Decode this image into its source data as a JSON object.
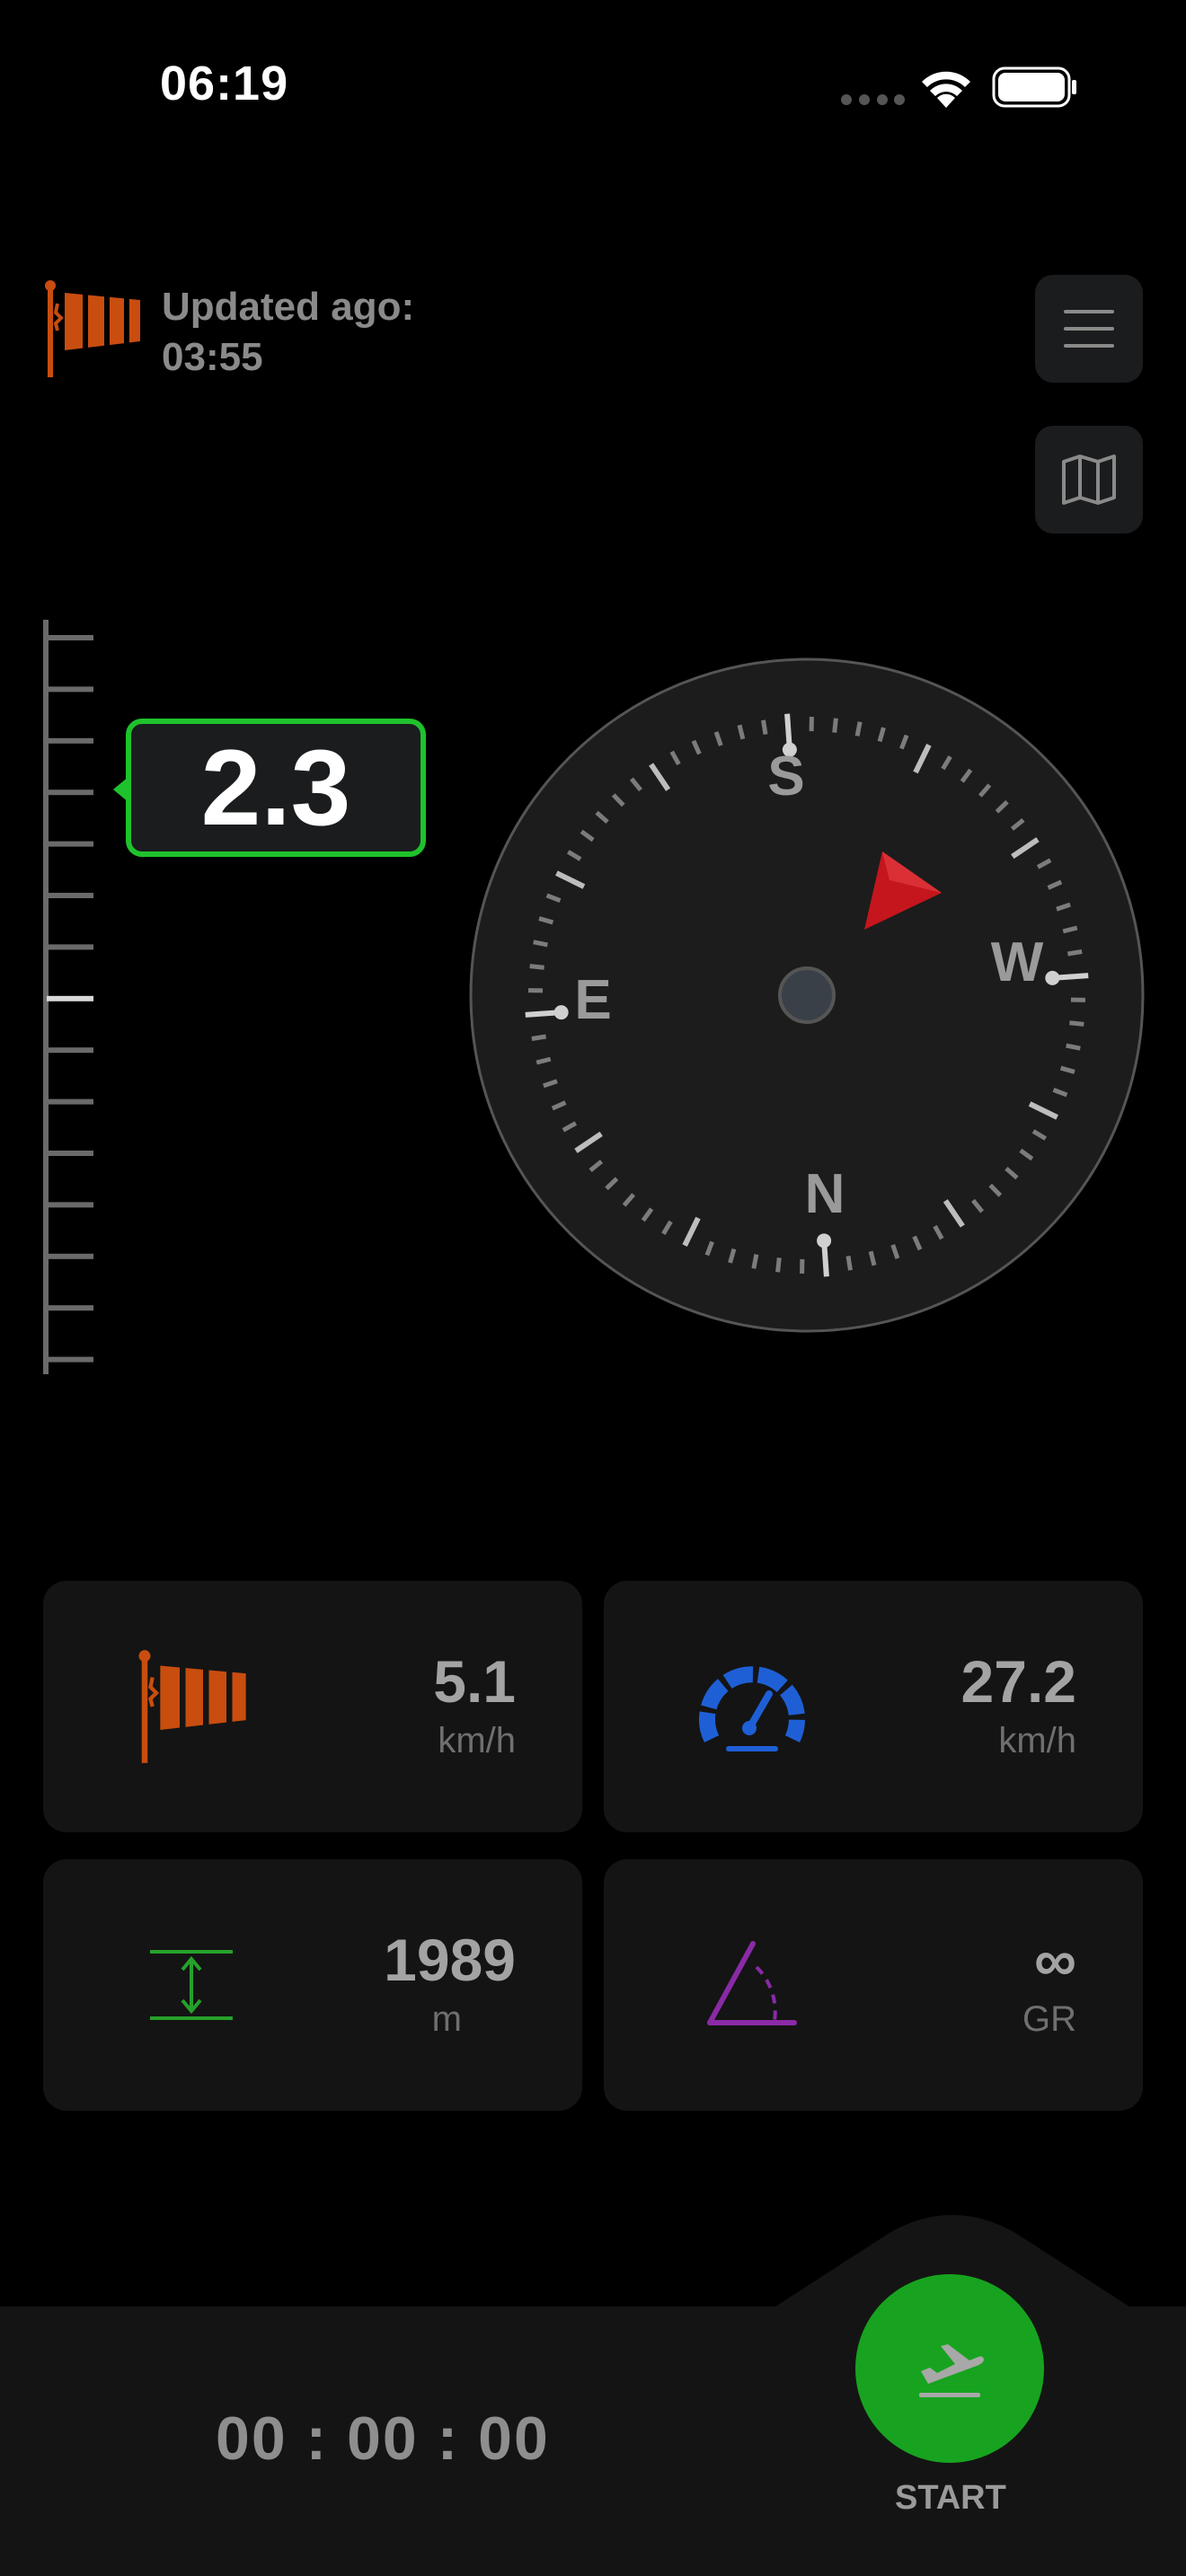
{
  "status_bar": {
    "time": "06:19"
  },
  "header": {
    "updated_label": "Updated ago:",
    "updated_value": "03:55"
  },
  "vario": {
    "value": "2.3",
    "accent": "#1fc22c"
  },
  "compass": {
    "labels": {
      "s": "S",
      "w": "W",
      "n": "N",
      "e": "E"
    },
    "needle_color": "#c4161c"
  },
  "tiles": {
    "wind": {
      "value": "5.1",
      "unit": "km/h",
      "icon": "windsock-icon",
      "color": "#c84d0f"
    },
    "speed": {
      "value": "27.2",
      "unit": "km/h",
      "icon": "speedometer-icon",
      "color": "#1f5fd6"
    },
    "altitude": {
      "value": "1989",
      "unit": "m",
      "icon": "altitude-icon",
      "color": "#25a12a"
    },
    "glide": {
      "value": "∞",
      "unit": "GR",
      "icon": "glide-angle-icon",
      "color": "#8a2aa6"
    }
  },
  "bottom": {
    "timer": "00 : 00 : 00",
    "start_label": "START"
  }
}
